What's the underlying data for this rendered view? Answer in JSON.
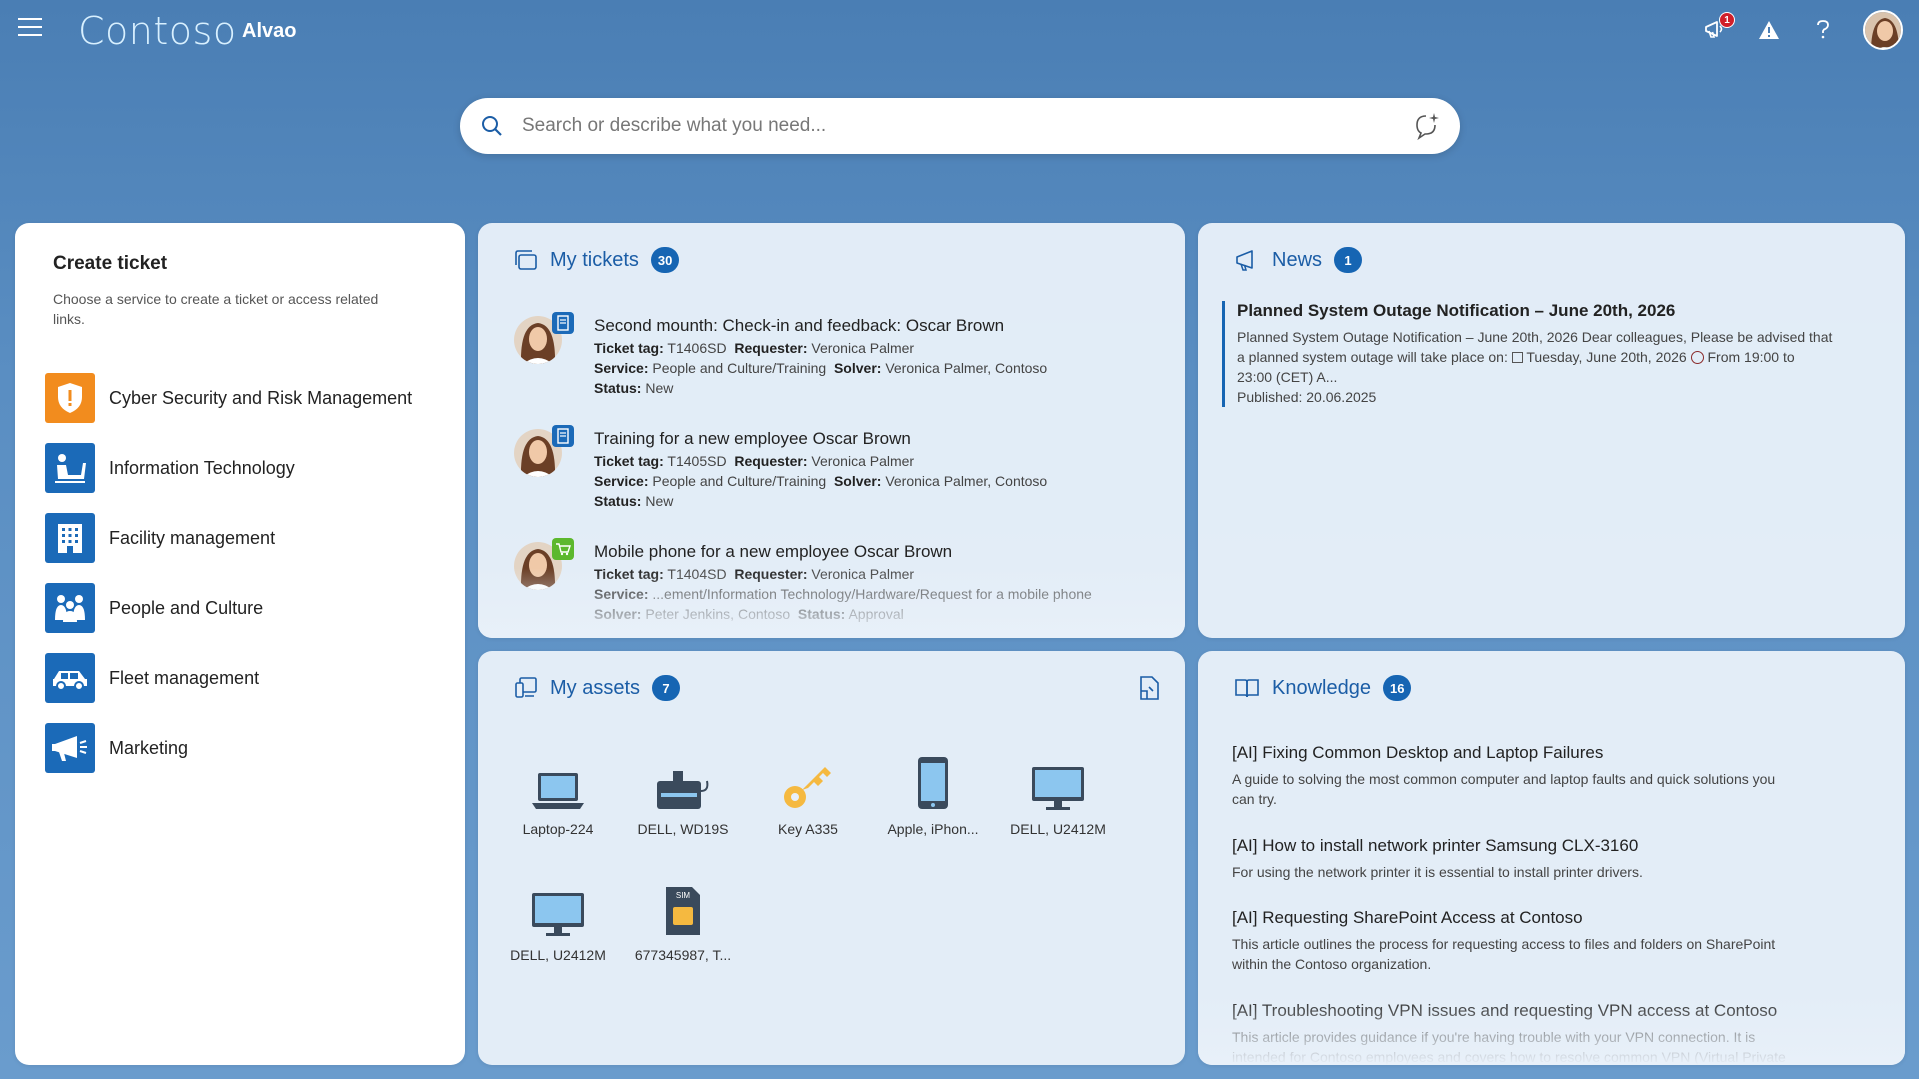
{
  "header": {
    "brand": "Contoso",
    "app_name": "Alvao",
    "notification_count": "1",
    "icons": [
      "menu-icon",
      "megaphone-icon",
      "warning-icon",
      "help-icon",
      "avatar"
    ]
  },
  "search": {
    "placeholder": "Search or describe what you need..."
  },
  "create_ticket": {
    "title": "Create ticket",
    "subtitle": "Choose a service to create a ticket or access related links.",
    "services": [
      {
        "label": "Cyber Security and Risk Management",
        "icon": "shield-icon",
        "color": "#f28c1e"
      },
      {
        "label": "Information Technology",
        "icon": "it-person-icon",
        "color": "#1b6ab8"
      },
      {
        "label": "Facility management",
        "icon": "building-icon",
        "color": "#1b6ab8"
      },
      {
        "label": "People and Culture",
        "icon": "people-icon",
        "color": "#1b6ab8"
      },
      {
        "label": "Fleet management",
        "icon": "car-icon",
        "color": "#1b6ab8"
      },
      {
        "label": "Marketing",
        "icon": "megaphone-icon",
        "color": "#1b6ab8"
      }
    ]
  },
  "my_tickets": {
    "title": "My tickets",
    "count": "30",
    "items": [
      {
        "title": "Second mounth: Check-in and feedback: Oscar Brown",
        "tag_label": "Ticket tag:",
        "tag": "T1406SD",
        "requester_label": "Requester:",
        "requester": "Veronica Palmer",
        "service_label": "Service:",
        "service": "People and Culture/Training",
        "solver_label": "Solver:",
        "solver": "Veronica Palmer, Contoso",
        "status_label": "Status:",
        "status": "New"
      },
      {
        "title": "Training for a new employee Oscar Brown",
        "tag_label": "Ticket tag:",
        "tag": "T1405SD",
        "requester_label": "Requester:",
        "requester": "Veronica Palmer",
        "service_label": "Service:",
        "service": "People and Culture/Training",
        "solver_label": "Solver:",
        "solver": "Veronica Palmer, Contoso",
        "status_label": "Status:",
        "status": "New"
      },
      {
        "title": "Mobile phone for a new employee Oscar Brown",
        "tag_label": "Ticket tag:",
        "tag": "T1404SD",
        "requester_label": "Requester:",
        "requester": "Veronica Palmer",
        "service_label": "Service:",
        "service": "...ement/Information Technology/Hardware/Request for a mobile phone",
        "solver_label": "Solver:",
        "solver": "Peter Jenkins, Contoso",
        "status_label": "Status:",
        "status": "Approval"
      }
    ]
  },
  "news": {
    "title": "News",
    "count": "1",
    "item": {
      "title": "Planned System Outage Notification – June 20th, 2026",
      "body_1": "Planned System Outage Notification – June 20th, 2026 Dear colleagues, Please be advised that",
      "body_2a": "a planned system outage will take place on: ",
      "body_2b": " Tuesday, June 20th, 2026 ",
      "body_2c": " From 19:00 to",
      "body_3": "23:00 (CET) A...",
      "published": "Published: 20.06.2025"
    }
  },
  "my_assets": {
    "title": "My assets",
    "count": "7",
    "items": [
      {
        "label": "Laptop-224",
        "icon": "laptop-icon"
      },
      {
        "label": "DELL, WD19S",
        "icon": "dock-icon"
      },
      {
        "label": "Key A335",
        "icon": "key-icon"
      },
      {
        "label": "Apple, iPhon...",
        "icon": "phone-icon"
      },
      {
        "label": "DELL, U2412M",
        "icon": "monitor-icon"
      },
      {
        "label": "DELL, U2412M",
        "icon": "monitor-icon"
      },
      {
        "label": "677345987, T...",
        "icon": "sim-card-icon"
      }
    ],
    "sim_text": "SIM"
  },
  "knowledge": {
    "title": "Knowledge",
    "count": "16",
    "items": [
      {
        "title": "[AI] Fixing Common Desktop and Laptop Failures",
        "desc_1": "A guide to solving the most common computer and laptop faults and quick solutions you",
        "desc_2": "can try."
      },
      {
        "title": "[AI] How to install network printer Samsung CLX-3160",
        "desc_1": "For using the network printer it is essential to install printer drivers.",
        "desc_2": ""
      },
      {
        "title": "[AI] Requesting SharePoint Access at Contoso",
        "desc_1": "This article outlines the process for requesting access to files and folders on SharePoint",
        "desc_2": "within the Contoso organization."
      },
      {
        "title": "[AI] Troubleshooting VPN issues and requesting VPN access at Contoso",
        "desc_1": "This article provides guidance if you're having trouble with your VPN connection. It is",
        "desc_2": "intended for Contoso employees and covers how to resolve common VPN (Virtual Private"
      }
    ]
  },
  "colors": {
    "accent": "#1665b3",
    "orange": "#f28c1e",
    "badge_red": "#d01f2a"
  }
}
